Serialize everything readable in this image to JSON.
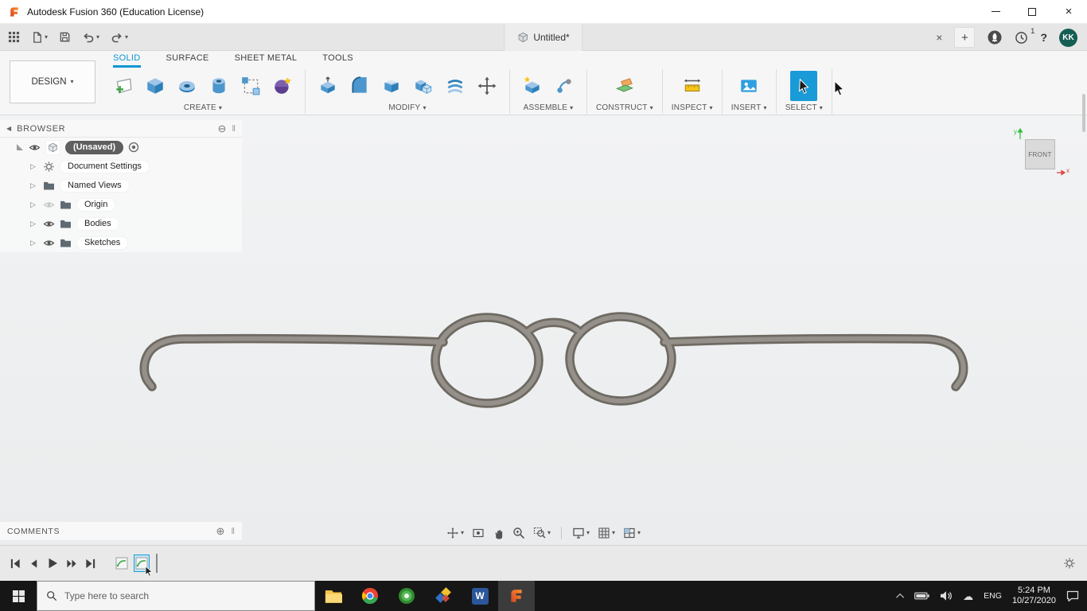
{
  "colors": {
    "accent_blue": "#0a96d5",
    "selection_blue": "#1a9bd7",
    "fusion_orange": "#ff8f2e",
    "frame_gray": "#8e8a81"
  },
  "glyphs": {
    "chevron_down": "▾",
    "tree_expand": "▷",
    "close": "×",
    "plus": "+",
    "grip": "‖",
    "circle_minus": "⊖",
    "circle_plus": "⊕",
    "collapse_left": "◀",
    "cloud": "☁"
  },
  "title_bar": {
    "title": "Autodesk Fusion 360 (Education License)"
  },
  "toolbar": {
    "document_tab": "Untitled*",
    "notification_count": "1",
    "help_label": "?",
    "avatar_initials": "KK"
  },
  "ribbon": {
    "design_label": "DESIGN",
    "tabs": [
      {
        "label": "SOLID"
      },
      {
        "label": "SURFACE"
      },
      {
        "label": "SHEET METAL"
      },
      {
        "label": "TOOLS"
      }
    ],
    "groups": [
      {
        "label": "CREATE"
      },
      {
        "label": "MODIFY"
      },
      {
        "label": "ASSEMBLE"
      },
      {
        "label": "CONSTRUCT"
      },
      {
        "label": "INSPECT"
      },
      {
        "label": "INSERT"
      },
      {
        "label": "SELECT"
      }
    ]
  },
  "browser": {
    "header": "BROWSER",
    "root_label": "(Unsaved)",
    "items": [
      {
        "label": "Document Settings"
      },
      {
        "label": "Named Views"
      },
      {
        "label": "Origin"
      },
      {
        "label": "Bodies"
      },
      {
        "label": "Sketches"
      }
    ]
  },
  "comments": {
    "label": "COMMENTS"
  },
  "viewcube": {
    "front": "FRONT",
    "x": "x",
    "y": "y"
  },
  "taskbar": {
    "search_placeholder": "Type here to search",
    "language": "ENG",
    "time": "5:24 PM",
    "date": "10/27/2020",
    "word_letter": "W"
  }
}
